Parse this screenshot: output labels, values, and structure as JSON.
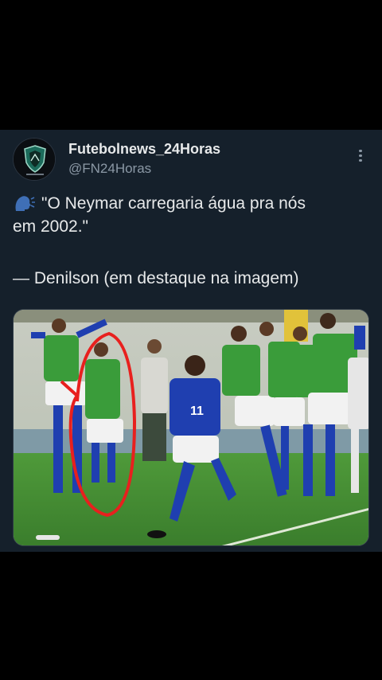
{
  "post": {
    "author": {
      "name": "Futebolnews_24Horas",
      "handle": "@FN24Horas",
      "avatar_icon": "shield-logo-icon"
    },
    "more_icon": "more-vertical-icon",
    "text_lines": [
      "\"O Neymar carregaria água pra nós",
      "em 2002.\"",
      "— Denilson (em destaque na imagem)"
    ],
    "speaker_icon": "speaking-head-icon",
    "photo": {
      "player_number": "11",
      "highlight_color": "#e8201e"
    }
  },
  "colors": {
    "background": "#15202b",
    "text_primary": "#e7e9ea",
    "text_secondary": "#8b98a5",
    "jersey_blue": "#1f3fb0",
    "bib_green": "#3a9c3a",
    "pitch_green": "#3f8a32"
  }
}
